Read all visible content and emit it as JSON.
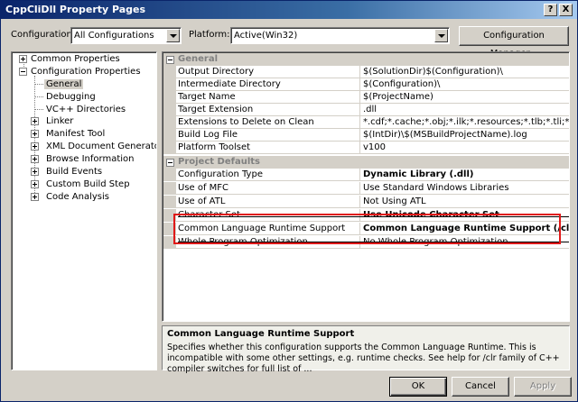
{
  "window": {
    "title": "CppCliDll Property Pages",
    "help_label": "?",
    "close_label": "X"
  },
  "header": {
    "configuration_label": "Configuration:",
    "configuration_value": "All Configurations",
    "platform_label": "Platform:",
    "platform_value": "Active(Win32)",
    "config_manager_label": "Configuration Manager..."
  },
  "tree": {
    "common_properties": "Common Properties",
    "configuration_properties": "Configuration Properties",
    "children": [
      "General",
      "Debugging",
      "VC++ Directories",
      "Linker",
      "Manifest Tool",
      "XML Document Generator",
      "Browse Information",
      "Build Events",
      "Custom Build Step",
      "Code Analysis"
    ]
  },
  "grid": {
    "general_header": "General",
    "general_rows": [
      {
        "name": "Output Directory",
        "value": "$(SolutionDir)$(Configuration)\\"
      },
      {
        "name": "Intermediate Directory",
        "value": "$(Configuration)\\"
      },
      {
        "name": "Target Name",
        "value": "$(ProjectName)"
      },
      {
        "name": "Target Extension",
        "value": ".dll"
      },
      {
        "name": "Extensions to Delete on Clean",
        "value": "*.cdf;*.cache;*.obj;*.ilk;*.resources;*.tlb;*.tli;*.tlh;*.tmp;"
      },
      {
        "name": "Build Log File",
        "value": "$(IntDir)\\$(MSBuildProjectName).log"
      },
      {
        "name": "Platform Toolset",
        "value": "v100"
      }
    ],
    "defaults_header": "Project Defaults",
    "defaults_rows": [
      {
        "name": "Configuration Type",
        "value": "Dynamic Library (.dll)"
      },
      {
        "name": "Use of MFC",
        "value": "Use Standard Windows Libraries"
      },
      {
        "name": "Use of ATL",
        "value": "Not Using ATL"
      },
      {
        "name": "Character Set",
        "value": "Use Unicode Character Set"
      },
      {
        "name": "Common Language Runtime Support",
        "value": "Common Language Runtime Support (/clr)"
      },
      {
        "name": "Whole Program Optimization",
        "value": "No Whole Program Optimization"
      }
    ]
  },
  "description": {
    "title": "Common Language Runtime Support",
    "text": "Specifies whether this configuration supports the Common Language Runtime. This is incompatible with some other settings, e.g. runtime checks. See help for /clr family of C++ compiler switches for full list of ..."
  },
  "buttons": {
    "ok": "OK",
    "cancel": "Cancel",
    "apply": "Apply"
  }
}
